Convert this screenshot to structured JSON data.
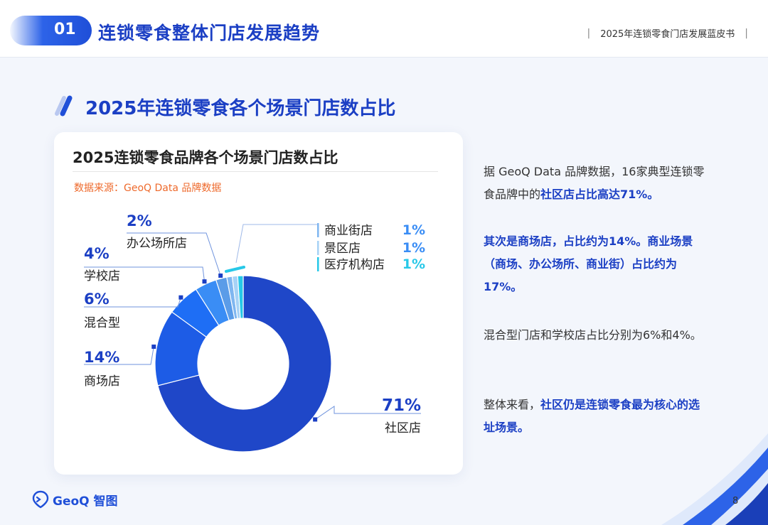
{
  "header": {
    "section_number": "01",
    "section_title": "连锁零食整体门店发展趋势",
    "report_title": "2025年连锁零食门店发展蓝皮书"
  },
  "subtitle": "2025年连锁零食各个场景门店数占比",
  "card": {
    "title": "2025连锁零食品牌各个场景门店数占比",
    "source": "数据来源：GeoQ Data 品牌数据"
  },
  "chart_data": {
    "type": "pie",
    "title": "2025连锁零食品牌各个场景门店数占比",
    "categories": [
      "社区店",
      "商场店",
      "混合型",
      "学校店",
      "办公场所店",
      "商业街店",
      "景区店",
      "医疗机构店"
    ],
    "values": [
      71,
      14,
      6,
      4,
      2,
      1,
      1,
      1
    ],
    "value_labels": [
      "71%",
      "14%",
      "6%",
      "4%",
      "2%",
      "1%",
      "1%",
      "1%"
    ],
    "colors": [
      "#1f47c8",
      "#1d5ce6",
      "#1e6ef5",
      "#3a8df5",
      "#5b9ce8",
      "#7fb6f0",
      "#a6d2f6",
      "#27c8e8"
    ],
    "donut": true
  },
  "summary": {
    "p1_a": "据 GeoQ Data 品牌数据，16家典型连锁零食品牌中的",
    "p1_b": "社区店占比高达71%。",
    "p2": "其次是商场店，占比约为14%。商业场景（商场、办公场所、商业街）占比约为17%。",
    "p3": "混合型门店和学校店占比分别为6%和4%。",
    "p4_a": "整体来看，",
    "p4_b": "社区仍是连锁零食最为核心的选址场景。"
  },
  "footer": {
    "logo_text": "GeoQ 智图",
    "page_number": "8"
  }
}
